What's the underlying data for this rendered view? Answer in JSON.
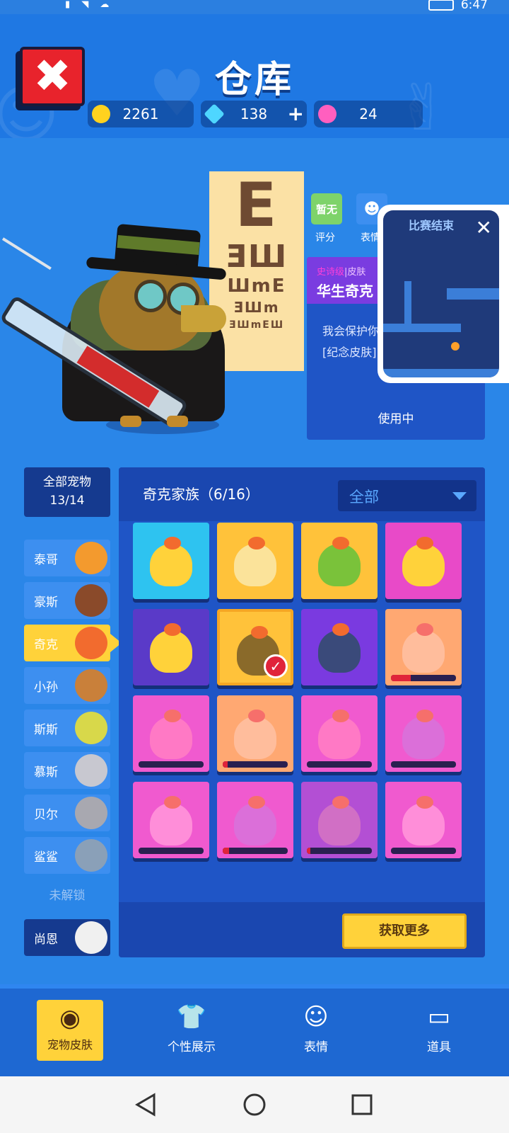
{
  "status_bar": {
    "time": "6:47"
  },
  "header": {
    "title": "仓库",
    "currencies": [
      {
        "icon": "gold-coin-icon",
        "value": "2261",
        "color": "#ffd21f"
      },
      {
        "icon": "diamond-icon",
        "value": "138",
        "color": "#4ed6ff",
        "plus": "+"
      },
      {
        "icon": "lotus-token-icon",
        "value": "24",
        "color": "#ff5fbf"
      }
    ]
  },
  "preview": {
    "chips": [
      {
        "text": "暂无",
        "label": "评分"
      },
      {
        "text": "☻",
        "label": "表情"
      }
    ],
    "info": {
      "tag_rarity": "史诗级",
      "tag_type": "|皮肤",
      "name": "华生奇克",
      "desc_line1": "我会保护你",
      "desc_line2": "[纪念皮肤]",
      "status": "使用中"
    },
    "video": {
      "title": "比赛结束",
      "close": "✕"
    }
  },
  "pets": {
    "all_label": "全部宠物",
    "all_count": "13/14",
    "items": [
      {
        "name": "泰哥",
        "color": "#f39a2e"
      },
      {
        "name": "豪斯",
        "color": "#8a4a2a"
      },
      {
        "name": "奇克",
        "color": "#f26b2e"
      },
      {
        "name": "小孙",
        "color": "#c9803a"
      },
      {
        "name": "斯斯",
        "color": "#d8d84a"
      },
      {
        "name": "慕斯",
        "color": "#c8c8d0"
      },
      {
        "name": "贝尔",
        "color": "#a8a8b0"
      },
      {
        "name": "鲨鲨",
        "color": "#8aa0b8"
      },
      {
        "name": "尚恩",
        "color": "#f0f0f0"
      }
    ],
    "locked_label": "未解锁"
  },
  "panel": {
    "title": "奇克家族（6/16）",
    "filter": "全部",
    "get_more": "获取更多",
    "tiles": [
      {
        "bg": "#2ec3f0",
        "chick": "#ffd23a",
        "owned": true,
        "progress": 0
      },
      {
        "bg": "#ffc23a",
        "chick": "#fbe39a",
        "owned": true,
        "progress": 0
      },
      {
        "bg": "#ffc23a",
        "chick": "#7ac23a",
        "owned": true,
        "progress": 0
      },
      {
        "bg": "#e84ac8",
        "chick": "#ffd23a",
        "owned": true,
        "progress": 0
      },
      {
        "bg": "#5a3ac8",
        "chick": "#ffd23a",
        "owned": true,
        "progress": 0
      },
      {
        "bg": "#ffc23a",
        "chick": "#8a6a2a",
        "owned": true,
        "equipped": true,
        "progress": 0
      },
      {
        "bg": "#7a3ae0",
        "chick": "#3a4a7a",
        "owned": true,
        "progress": 0
      },
      {
        "bg": "#ffc23a",
        "chick": "#ffe27a",
        "owned": false,
        "progress": 0.3
      },
      {
        "bg": "#e84ac8",
        "chick": "#ff7ab8",
        "owned": false,
        "progress": 0
      },
      {
        "bg": "#ffc23a",
        "chick": "#ffe27a",
        "owned": false,
        "progress": 0.08
      },
      {
        "bg": "#e84ac8",
        "chick": "#ff7ab8",
        "owned": false,
        "progress": 0
      },
      {
        "bg": "#e84ac8",
        "chick": "#c86ad8",
        "owned": false,
        "progress": 0
      },
      {
        "bg": "#e84ac8",
        "chick": "#ff9ad8",
        "owned": false,
        "progress": 0
      },
      {
        "bg": "#e84ac8",
        "chick": "#c86ad8",
        "owned": false,
        "progress": 0.1
      },
      {
        "bg": "#8a3ad0",
        "chick": "#b86ab8",
        "owned": false,
        "progress": 0.05
      },
      {
        "bg": "#e84ac8",
        "chick": "#ff9ad8",
        "owned": false,
        "progress": 0
      }
    ]
  },
  "bottom_nav": [
    {
      "label": "宠物皮肤",
      "icon": "pet-skin-icon",
      "glyph": "◉",
      "active": true
    },
    {
      "label": "个性展示",
      "icon": "tshirt-icon",
      "glyph": "👕",
      "active": false
    },
    {
      "label": "表情",
      "icon": "emote-icon",
      "glyph": "☺",
      "active": false
    },
    {
      "label": "道具",
      "icon": "card-icon",
      "glyph": "▭",
      "active": false
    }
  ]
}
